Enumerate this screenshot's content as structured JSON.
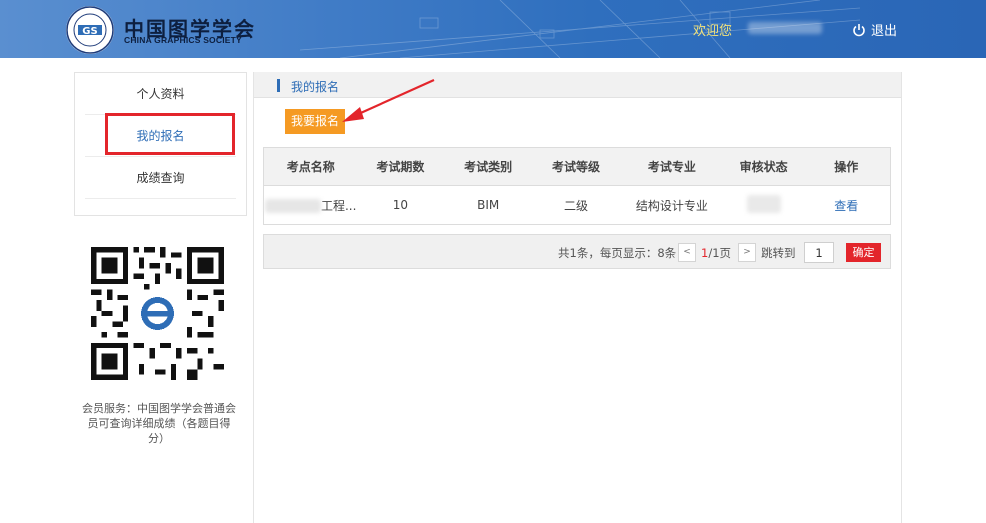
{
  "header": {
    "org_name_cn": "中国图学学会",
    "org_name_en": "CHINA GRAPHICS SOCIETY",
    "welcome": "欢迎您",
    "logout": "退出"
  },
  "sidebar": {
    "items": [
      {
        "label": "个人资料"
      },
      {
        "label": "我的报名"
      },
      {
        "label": "成绩查询"
      }
    ],
    "qr_caption": "会员服务：中国图学学会普通会员可查询详细成绩（各题目得分）"
  },
  "main": {
    "section_title": "我的报名",
    "enroll_button": "我要报名",
    "table": {
      "headers": [
        "考点名称",
        "考试期数",
        "考试类别",
        "考试等级",
        "考试专业",
        "审核状态",
        "操作"
      ],
      "rows": [
        {
          "site": "工程...",
          "period": "10",
          "category": "BIM",
          "level": "二级",
          "major": "结构设计专业",
          "status": "",
          "action": "查看"
        }
      ]
    },
    "pager": {
      "summary": "共1条，每页显示：8条",
      "prev": "<",
      "next": ">",
      "current": "1",
      "total": "/1页",
      "jump_label": "跳转到",
      "jump_value": "1",
      "confirm": "确定"
    }
  },
  "colors": {
    "accent_blue": "#2e6db6",
    "orange": "#f59a23",
    "red": "#e3252b"
  }
}
